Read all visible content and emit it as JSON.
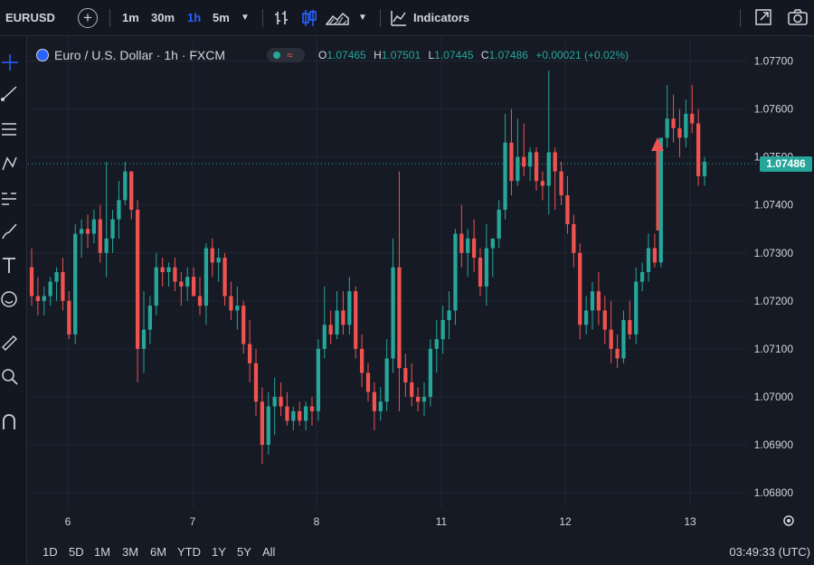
{
  "toolbar": {
    "symbol": "EURUSD",
    "timeframes": [
      "1m",
      "30m",
      "1h",
      "5m"
    ],
    "active_timeframe": "1h",
    "indicators_label": "Indicators"
  },
  "legend": {
    "title": "Euro / U.S. Dollar · 1h · FXCM",
    "o_label": "O",
    "o_value": "1.07465",
    "h_label": "H",
    "h_value": "1.07501",
    "l_label": "L",
    "l_value": "1.07445",
    "c_label": "C",
    "c_value": "1.07486",
    "change": "+0.00021 (+0.02%)"
  },
  "price_axis": {
    "ticks": [
      "1.07700",
      "1.07600",
      "1.07500",
      "1.07400",
      "1.07300",
      "1.07200",
      "1.07100",
      "1.07000",
      "1.06900",
      "1.06800"
    ],
    "last_price": "1.07486"
  },
  "time_axis": {
    "ticks": [
      "6",
      "7",
      "8",
      "11",
      "12",
      "13"
    ]
  },
  "ranges": [
    "1D",
    "5D",
    "1M",
    "3M",
    "6M",
    "YTD",
    "1Y",
    "5Y",
    "All"
  ],
  "clock": "03:49:33 (UTC)",
  "colors": {
    "up": "#26a69a",
    "down": "#ef5350",
    "bg": "#161a25",
    "accent": "#2962ff"
  },
  "chart_data": {
    "type": "candlestick",
    "x_ticks": [
      "6",
      "7",
      "8",
      "11",
      "12",
      "13"
    ],
    "ylim": [
      1.0677,
      1.0775
    ],
    "candles": [
      [
        1.0727,
        1.0731,
        1.0719,
        1.0721
      ],
      [
        1.0721,
        1.0725,
        1.0717,
        1.072
      ],
      [
        1.072,
        1.0723,
        1.0717,
        1.0721
      ],
      [
        1.0721,
        1.0725,
        1.0719,
        1.0724
      ],
      [
        1.0724,
        1.0727,
        1.072,
        1.0726
      ],
      [
        1.0726,
        1.0729,
        1.0718,
        1.072
      ],
      [
        1.072,
        1.0722,
        1.0712,
        1.0713
      ],
      [
        1.0713,
        1.0736,
        1.0711,
        1.0734
      ],
      [
        1.0734,
        1.0737,
        1.0729,
        1.0735
      ],
      [
        1.0735,
        1.0738,
        1.0731,
        1.0734
      ],
      [
        1.0734,
        1.0739,
        1.0732,
        1.0737
      ],
      [
        1.0737,
        1.074,
        1.0728,
        1.073
      ],
      [
        1.073,
        1.0749,
        1.0725,
        1.0733
      ],
      [
        1.0733,
        1.0739,
        1.073,
        1.0737
      ],
      [
        1.0737,
        1.0745,
        1.0733,
        1.0741
      ],
      [
        1.0741,
        1.0749,
        1.074,
        1.0747
      ],
      [
        1.0747,
        1.0747,
        1.0737,
        1.0739
      ],
      [
        1.0739,
        1.0741,
        1.0703,
        1.071
      ],
      [
        1.071,
        1.0722,
        1.0705,
        1.0714
      ],
      [
        1.0714,
        1.0721,
        1.0711,
        1.0719
      ],
      [
        1.0719,
        1.073,
        1.0717,
        1.0727
      ],
      [
        1.0727,
        1.0729,
        1.0723,
        1.0726
      ],
      [
        1.0726,
        1.0728,
        1.0723,
        1.0727
      ],
      [
        1.0727,
        1.0729,
        1.0722,
        1.0724
      ],
      [
        1.0724,
        1.0726,
        1.0719,
        1.0723
      ],
      [
        1.0723,
        1.0727,
        1.072,
        1.0725
      ],
      [
        1.0725,
        1.0727,
        1.0722,
        1.0721
      ],
      [
        1.0721,
        1.0725,
        1.0717,
        1.0719
      ],
      [
        1.0719,
        1.0732,
        1.0715,
        1.0731
      ],
      [
        1.0731,
        1.0733,
        1.0725,
        1.0728
      ],
      [
        1.0728,
        1.0731,
        1.0724,
        1.0729
      ],
      [
        1.0729,
        1.073,
        1.0719,
        1.0721
      ],
      [
        1.0721,
        1.0724,
        1.0716,
        1.0718
      ],
      [
        1.0718,
        1.0723,
        1.0714,
        1.0719
      ],
      [
        1.0719,
        1.072,
        1.0709,
        1.0711
      ],
      [
        1.0711,
        1.0716,
        1.0703,
        1.0707
      ],
      [
        1.0707,
        1.071,
        1.0696,
        1.0699
      ],
      [
        1.0699,
        1.0702,
        1.0686,
        1.069
      ],
      [
        1.069,
        1.0701,
        1.0688,
        1.0698
      ],
      [
        1.0698,
        1.0704,
        1.0692,
        1.07
      ],
      [
        1.07,
        1.0703,
        1.0696,
        1.0698
      ],
      [
        1.0698,
        1.0701,
        1.0694,
        1.0695
      ],
      [
        1.0695,
        1.0698,
        1.0693,
        1.0697
      ],
      [
        1.0697,
        1.0699,
        1.0694,
        1.0695
      ],
      [
        1.0695,
        1.0699,
        1.0693,
        1.0698
      ],
      [
        1.0698,
        1.07,
        1.0694,
        1.0697
      ],
      [
        1.0697,
        1.0712,
        1.0695,
        1.071
      ],
      [
        1.071,
        1.0723,
        1.0708,
        1.0715
      ],
      [
        1.0715,
        1.0718,
        1.0711,
        1.0713
      ],
      [
        1.0713,
        1.0722,
        1.0712,
        1.0718
      ],
      [
        1.0718,
        1.0722,
        1.0713,
        1.0715
      ],
      [
        1.0715,
        1.0725,
        1.0713,
        1.0722
      ],
      [
        1.0722,
        1.0723,
        1.0708,
        1.071
      ],
      [
        1.071,
        1.0713,
        1.0702,
        1.0705
      ],
      [
        1.0705,
        1.0707,
        1.0699,
        1.0701
      ],
      [
        1.0701,
        1.0703,
        1.0693,
        1.0697
      ],
      [
        1.0697,
        1.0702,
        1.0695,
        1.0699
      ],
      [
        1.0699,
        1.0712,
        1.0697,
        1.0708
      ],
      [
        1.0708,
        1.0733,
        1.0705,
        1.0727
      ],
      [
        1.0727,
        1.0747,
        1.0697,
        1.0706
      ],
      [
        1.0706,
        1.0709,
        1.07,
        1.0703
      ],
      [
        1.0703,
        1.0707,
        1.0698,
        1.07
      ],
      [
        1.07,
        1.0702,
        1.0697,
        1.0699
      ],
      [
        1.0699,
        1.0703,
        1.0696,
        1.07
      ],
      [
        1.07,
        1.0712,
        1.0698,
        1.071
      ],
      [
        1.071,
        1.0716,
        1.0705,
        1.0712
      ],
      [
        1.0712,
        1.0719,
        1.0709,
        1.0716
      ],
      [
        1.0716,
        1.0722,
        1.0712,
        1.0718
      ],
      [
        1.0718,
        1.0735,
        1.0715,
        1.0734
      ],
      [
        1.0734,
        1.074,
        1.0727,
        1.073
      ],
      [
        1.073,
        1.0735,
        1.0725,
        1.0733
      ],
      [
        1.0733,
        1.0737,
        1.0726,
        1.0729
      ],
      [
        1.0729,
        1.0731,
        1.0721,
        1.0723
      ],
      [
        1.0723,
        1.0736,
        1.0719,
        1.0731
      ],
      [
        1.0731,
        1.0733,
        1.0725,
        1.0733
      ],
      [
        1.0733,
        1.0741,
        1.0731,
        1.0739
      ],
      [
        1.0739,
        1.0759,
        1.0737,
        1.0753
      ],
      [
        1.0753,
        1.076,
        1.0742,
        1.0745
      ],
      [
        1.0745,
        1.0758,
        1.0744,
        1.075
      ],
      [
        1.075,
        1.0757,
        1.0746,
        1.0748
      ],
      [
        1.0748,
        1.0752,
        1.0745,
        1.0751
      ],
      [
        1.0751,
        1.0752,
        1.0743,
        1.0745
      ],
      [
        1.0745,
        1.0747,
        1.0741,
        1.0744
      ],
      [
        1.0744,
        1.0768,
        1.0738,
        1.0751
      ],
      [
        1.0751,
        1.0752,
        1.0739,
        1.0747
      ],
      [
        1.0747,
        1.0749,
        1.074,
        1.0742
      ],
      [
        1.0742,
        1.0746,
        1.0734,
        1.0736
      ],
      [
        1.0736,
        1.0738,
        1.0727,
        1.073
      ],
      [
        1.073,
        1.0732,
        1.0712,
        1.0715
      ],
      [
        1.0715,
        1.0721,
        1.0713,
        1.0718
      ],
      [
        1.0718,
        1.0724,
        1.0714,
        1.0722
      ],
      [
        1.0722,
        1.0726,
        1.0715,
        1.0718
      ],
      [
        1.0718,
        1.0721,
        1.0711,
        1.0714
      ],
      [
        1.0714,
        1.072,
        1.0707,
        1.071
      ],
      [
        1.071,
        1.0713,
        1.0706,
        1.0708
      ],
      [
        1.0708,
        1.0718,
        1.0707,
        1.0716
      ],
      [
        1.0716,
        1.072,
        1.0712,
        1.0713
      ],
      [
        1.0713,
        1.0727,
        1.0711,
        1.0724
      ],
      [
        1.0724,
        1.0728,
        1.0722,
        1.0726
      ],
      [
        1.0726,
        1.0734,
        1.0724,
        1.0731
      ],
      [
        1.0731,
        1.0734,
        1.0727,
        1.0728
      ],
      [
        1.0728,
        1.075,
        1.0727,
        1.0754
      ],
      [
        1.0754,
        1.0765,
        1.0752,
        1.0758
      ],
      [
        1.0758,
        1.0763,
        1.0753,
        1.0756
      ],
      [
        1.0756,
        1.076,
        1.075,
        1.0754
      ],
      [
        1.0754,
        1.0762,
        1.0752,
        1.0759
      ],
      [
        1.0759,
        1.0765,
        1.0755,
        1.0757
      ],
      [
        1.0757,
        1.076,
        1.0744,
        1.0746
      ],
      [
        1.0746,
        1.075,
        1.0744,
        1.0749
      ]
    ]
  }
}
